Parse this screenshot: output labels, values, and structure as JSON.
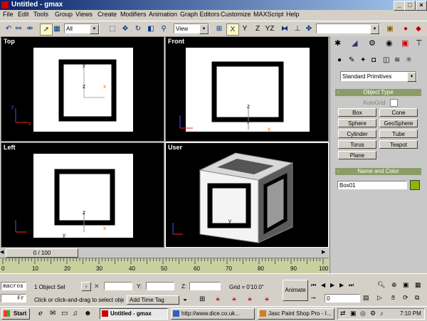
{
  "window": {
    "title": "Untitled - gmax"
  },
  "menu": [
    "File",
    "Edit",
    "Tools",
    "Group",
    "Views",
    "Create",
    "Modifiers",
    "Animation",
    "Graph Editors",
    "Customize",
    "MAXScript",
    "Help"
  ],
  "toolbar": {
    "selection_filter": "All",
    "reference_coord": "View",
    "axis_labels": [
      "X",
      "Y",
      "Z",
      "YZ"
    ],
    "named_selection": ""
  },
  "viewports": [
    {
      "label": "Top"
    },
    {
      "label": "Front"
    },
    {
      "label": "Left"
    },
    {
      "label": "User"
    }
  ],
  "command_panel": {
    "category": "Standard Primitives",
    "object_type_title": "Object Type",
    "autogrid_label": "AutoGrid",
    "primitives": [
      "Box",
      "Cone",
      "Sphere",
      "GeoSphere",
      "Cylinder",
      "Tube",
      "Torus",
      "Teapot",
      "Plane"
    ],
    "name_color_title": "Name and Color",
    "object_name": "Box01",
    "object_color": "#8cb400"
  },
  "timeline": {
    "frame_display": "0 / 100",
    "ticks": [
      "0",
      "10",
      "20",
      "30",
      "40",
      "50",
      "60",
      "70",
      "80",
      "90",
      "100"
    ]
  },
  "status": {
    "macros_label": "macros",
    "fr_label": "Fr",
    "selection_info": "1 Object Sel",
    "prompt": "Click or click-and-drag to select obje",
    "add_time_tag": "Add Time Tag",
    "x_label": "X:",
    "y_label": "Y:",
    "z_label": "Z:",
    "grid": "Grid = 0'10.0\"",
    "animate": "Animate",
    "frame_value": "0"
  },
  "taskbar": {
    "start": "Start",
    "tasks": [
      "Untitled - gmax",
      "http://www.dice.co.uk...",
      "Jasc Paint Shop Pro - I..."
    ],
    "clock": "7:10 PM"
  },
  "colors": {
    "viewport_bg": "#000000",
    "rollout_head": "#8a9c68",
    "object_color": "#8cb400",
    "timeline_bg": "#c8d0a0"
  }
}
